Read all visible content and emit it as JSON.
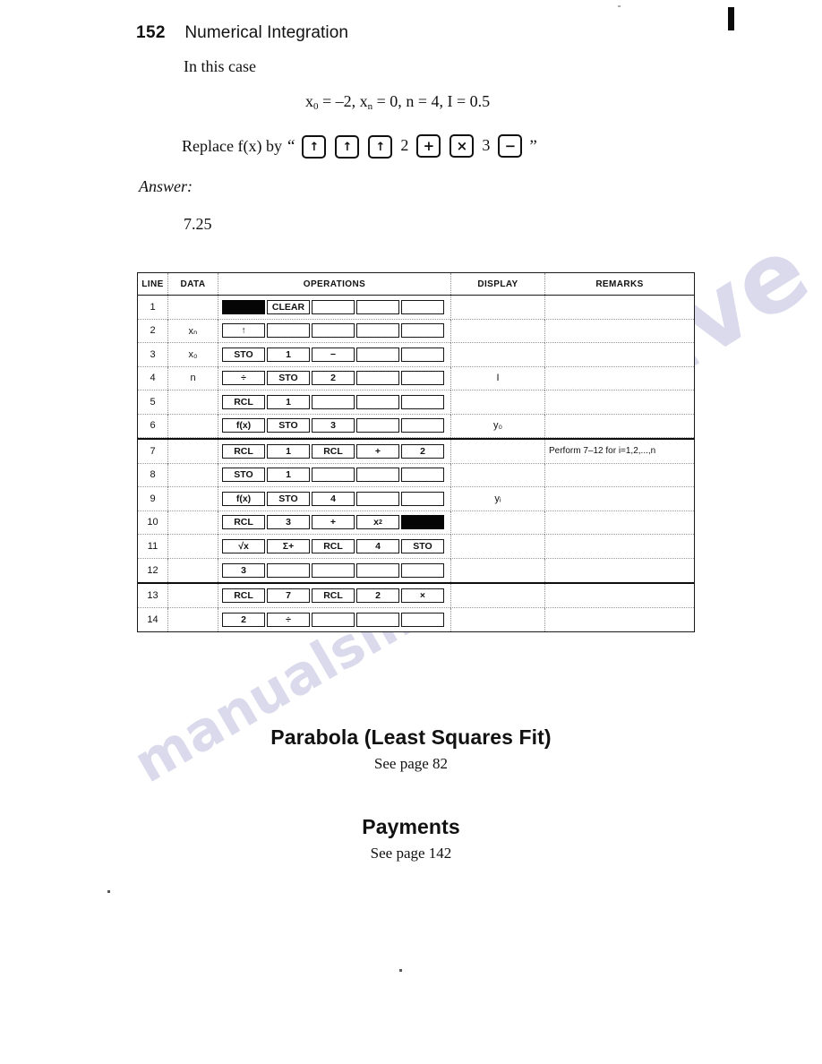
{
  "page": {
    "number": "152",
    "chapter_title": "Numerical Integration",
    "top_mark_icon": "black-bar-mark"
  },
  "body": {
    "intro_line": "In this case",
    "formula": {
      "x0_label": "x",
      "x0_sub": "0",
      "x0_value": "= –2,",
      "xn_label": "x",
      "xn_sub": "n",
      "xn_value": "= 0,",
      "n_value": "n = 4,",
      "I_value": "I = 0.5"
    },
    "replace_line": {
      "prefix": "Replace f(x) by",
      "open_quote": "“",
      "close_quote": "”",
      "keys": [
        {
          "glyph": "↑",
          "name": "enter-arrow-key"
        },
        {
          "glyph": "↑",
          "name": "enter-arrow-key"
        },
        {
          "glyph": "↑",
          "name": "enter-arrow-key"
        },
        {
          "glyph": "2",
          "name": "digit-two",
          "plain": true
        },
        {
          "glyph": "+",
          "name": "plus-key"
        },
        {
          "glyph": "×",
          "name": "multiply-key"
        },
        {
          "glyph": "3",
          "name": "digit-three",
          "plain": true
        },
        {
          "glyph": "−",
          "name": "minus-key"
        }
      ]
    },
    "answer_label": "Answer:",
    "answer_value": "7.25"
  },
  "table": {
    "headers": [
      "LINE",
      "DATA",
      "OPERATIONS",
      "DISPLAY",
      "REMARKS"
    ],
    "rows": [
      {
        "line": "1",
        "data": "",
        "ops": [
          {
            "t": "",
            "fill": true
          },
          {
            "t": "CLEAR"
          },
          {
            "t": ""
          },
          {
            "t": ""
          },
          {
            "t": ""
          }
        ],
        "display": "",
        "remarks": ""
      },
      {
        "line": "2",
        "data": "xₙ",
        "ops": [
          {
            "t": "↑"
          },
          {
            "t": ""
          },
          {
            "t": ""
          },
          {
            "t": ""
          },
          {
            "t": ""
          }
        ],
        "display": "",
        "remarks": ""
      },
      {
        "line": "3",
        "data": "x₀",
        "ops": [
          {
            "t": "STO"
          },
          {
            "t": "1"
          },
          {
            "t": "−"
          },
          {
            "t": ""
          },
          {
            "t": ""
          }
        ],
        "display": "",
        "remarks": ""
      },
      {
        "line": "4",
        "data": "n",
        "ops": [
          {
            "t": "÷"
          },
          {
            "t": "STO"
          },
          {
            "t": "2"
          },
          {
            "t": ""
          },
          {
            "t": ""
          }
        ],
        "display": "I",
        "remarks": ""
      },
      {
        "line": "5",
        "data": "",
        "ops": [
          {
            "t": "RCL"
          },
          {
            "t": "1"
          },
          {
            "t": ""
          },
          {
            "t": ""
          },
          {
            "t": ""
          }
        ],
        "display": "",
        "remarks": ""
      },
      {
        "line": "6",
        "data": "",
        "ops": [
          {
            "t": "f(x)"
          },
          {
            "t": "STO"
          },
          {
            "t": "3"
          },
          {
            "t": ""
          },
          {
            "t": ""
          }
        ],
        "display": "y₀",
        "remarks": ""
      },
      {
        "line": "7",
        "data": "",
        "ops": [
          {
            "t": "RCL"
          },
          {
            "t": "1"
          },
          {
            "t": "RCL"
          },
          {
            "t": "+"
          },
          {
            "t": "2"
          }
        ],
        "display": "",
        "remarks": "Perform 7–12 for i=1,2,...,n"
      },
      {
        "line": "8",
        "data": "",
        "ops": [
          {
            "t": "STO"
          },
          {
            "t": "1"
          },
          {
            "t": ""
          },
          {
            "t": ""
          },
          {
            "t": ""
          }
        ],
        "display": "",
        "remarks": ""
      },
      {
        "line": "9",
        "data": "",
        "ops": [
          {
            "t": "f(x)"
          },
          {
            "t": "STO"
          },
          {
            "t": "4"
          },
          {
            "t": ""
          },
          {
            "t": ""
          }
        ],
        "display": "yᵢ",
        "remarks": ""
      },
      {
        "line": "10",
        "data": "",
        "ops": [
          {
            "t": "RCL"
          },
          {
            "t": "3"
          },
          {
            "t": "+"
          },
          {
            "t": "x²"
          },
          {
            "t": "",
            "fill": true
          }
        ],
        "display": "",
        "remarks": ""
      },
      {
        "line": "11",
        "data": "",
        "ops": [
          {
            "t": "√x"
          },
          {
            "t": "Σ+"
          },
          {
            "t": "RCL"
          },
          {
            "t": "4"
          },
          {
            "t": "STO"
          }
        ],
        "display": "",
        "remarks": ""
      },
      {
        "line": "12",
        "data": "",
        "ops": [
          {
            "t": "3"
          },
          {
            "t": ""
          },
          {
            "t": ""
          },
          {
            "t": ""
          },
          {
            "t": ""
          }
        ],
        "display": "",
        "remarks": ""
      },
      {
        "line": "13",
        "data": "",
        "ops": [
          {
            "t": "RCL"
          },
          {
            "t": "7"
          },
          {
            "t": "RCL"
          },
          {
            "t": "2"
          },
          {
            "t": "×"
          }
        ],
        "display": "",
        "remarks": ""
      },
      {
        "line": "14",
        "data": "",
        "ops": [
          {
            "t": "2"
          },
          {
            "t": "÷"
          },
          {
            "t": ""
          },
          {
            "t": ""
          },
          {
            "t": ""
          }
        ],
        "display": "",
        "remarks": ""
      }
    ]
  },
  "sections": [
    {
      "title": "Parabola (Least Squares Fit)",
      "subtitle": "See page 82"
    },
    {
      "title": "Payments",
      "subtitle": "See page 142"
    }
  ],
  "watermark": {
    "fragment_a": "rchive",
    "fragment_b": "manualslib.com",
    "fragment_c": "sive"
  }
}
